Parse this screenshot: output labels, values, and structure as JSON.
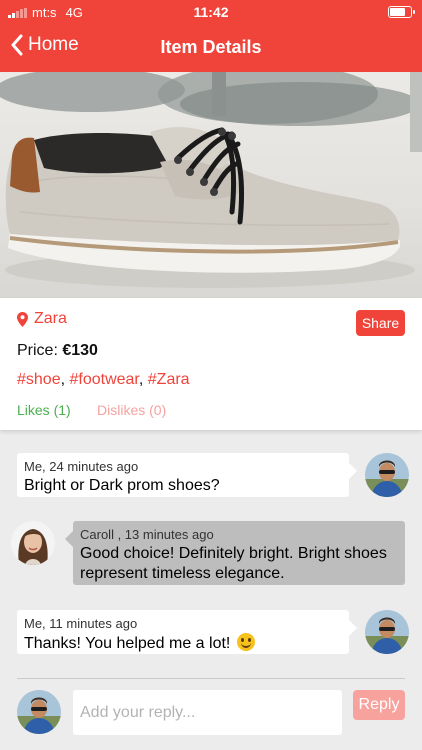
{
  "status_bar": {
    "carrier": "mt:s",
    "network": "4G",
    "time": "11:42",
    "signal_bars_filled": 2,
    "signal_bars_total": 5,
    "battery_level": 0.8
  },
  "nav": {
    "back_label": "Home",
    "title": "Item Details"
  },
  "item": {
    "image_subject": "grey canvas lace-up shoe with brown heel",
    "store": "Zara",
    "share_label": "Share",
    "price_label": "Price:",
    "price_value": "€130",
    "tags": [
      "#shoe",
      "#footwear",
      "#Zara"
    ],
    "likes_label": "Likes (1)",
    "dislikes_label": "Dislikes (0)"
  },
  "messages": [
    {
      "meta": "Me, 24 minutes ago",
      "text": "Bright or Dark prom shoes?"
    },
    {
      "meta": "Caroll , 13 minutes ago",
      "text_line1": "Good choice! Definitely bright. Bright shoes",
      "text_line2": "represent timeless elegance."
    },
    {
      "meta": "Me, 11 minutes ago",
      "text": "Thanks! You helped me a lot!",
      "emoji": "slightly-smiling-face"
    }
  ],
  "reply": {
    "placeholder": "Add your reply...",
    "button_label": "Reply"
  },
  "colors": {
    "accent": "#f0433a",
    "likes": "#4caf50",
    "dislikes": "#f5a3a0",
    "reply_button_disabled": "#f7a29d",
    "other_bubble": "#bdbdbd",
    "background": "#ececec"
  },
  "icons": {
    "back": "chevron-left-icon",
    "location": "map-pin-icon",
    "battery": "battery-icon",
    "signal": "signal-bars-icon"
  }
}
